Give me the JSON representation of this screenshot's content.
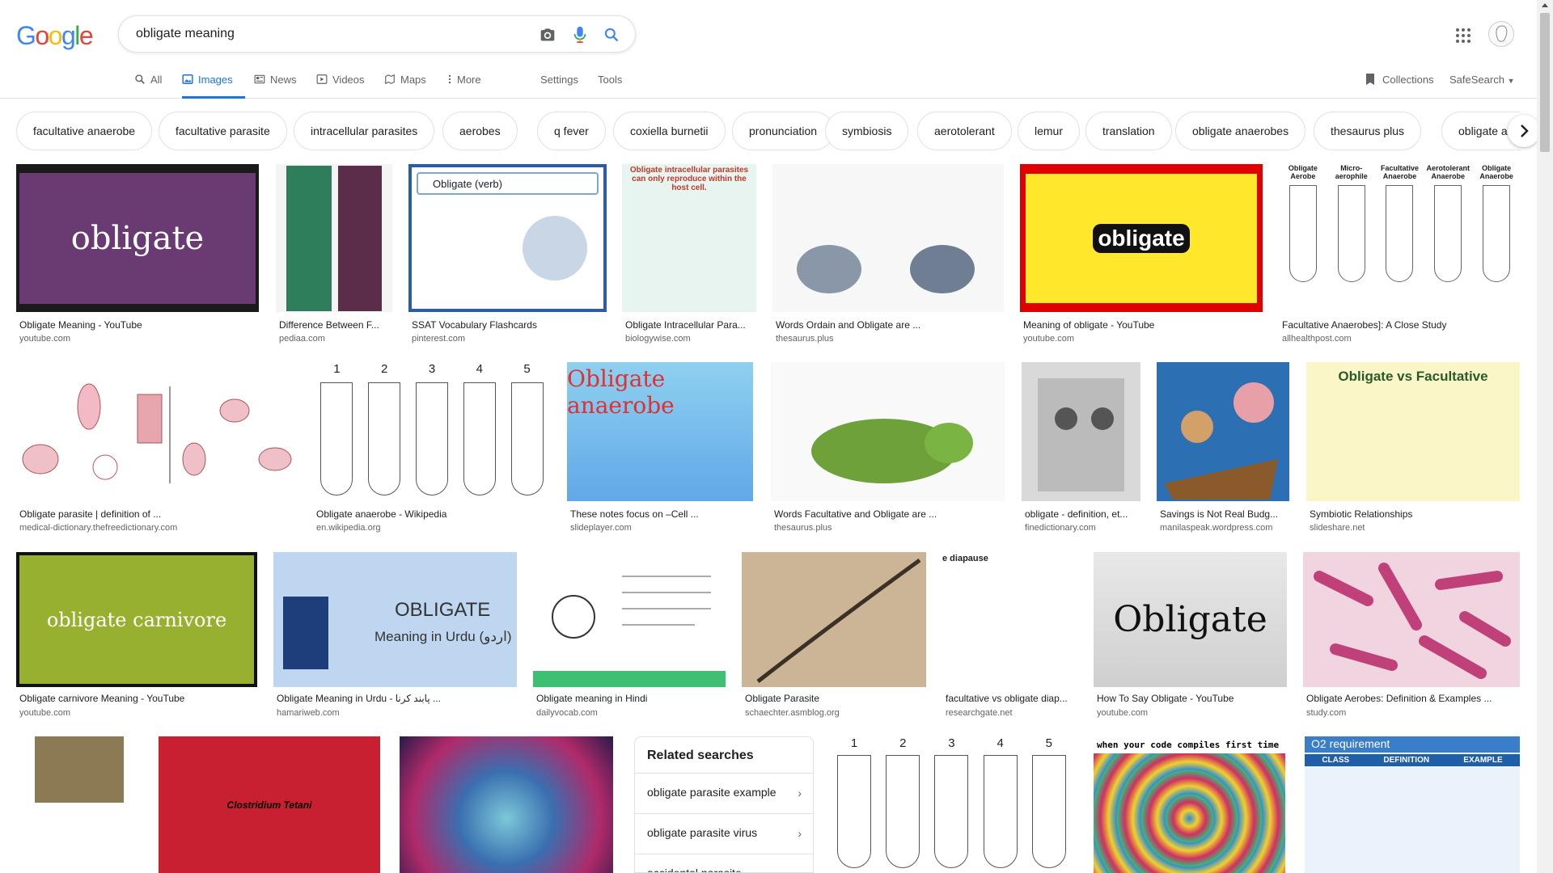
{
  "logo": {
    "letters": [
      {
        "ch": "G",
        "color": "#4285F4"
      },
      {
        "ch": "o",
        "color": "#EA4335"
      },
      {
        "ch": "o",
        "color": "#FBBC05"
      },
      {
        "ch": "g",
        "color": "#4285F4"
      },
      {
        "ch": "l",
        "color": "#34A853"
      },
      {
        "ch": "e",
        "color": "#EA4335"
      }
    ]
  },
  "search": {
    "query": "obligate meaning"
  },
  "icons": {
    "camera": "camera-icon",
    "mic": "mic-icon",
    "search": "search-icon",
    "apps": "apps-grid-icon",
    "collections": "bookmark-icon"
  },
  "tabs": [
    {
      "label": "All",
      "icon": "search-icon"
    },
    {
      "label": "Images",
      "icon": "image-icon",
      "active": true
    },
    {
      "label": "News",
      "icon": "news-icon"
    },
    {
      "label": "Videos",
      "icon": "video-icon"
    },
    {
      "label": "Maps",
      "icon": "map-icon"
    },
    {
      "label": "More",
      "icon": "more-icon"
    },
    {
      "label": "Settings"
    },
    {
      "label": "Tools"
    }
  ],
  "collections_label": "Collections",
  "safesearch_label": "SafeSearch",
  "chips": [
    "facultative anaerobe",
    "facultative parasite",
    "intracellular parasites",
    "aerobes",
    "q fever",
    "coxiella burnetii",
    "pronunciation",
    "symbiosis",
    "aerotolerant",
    "lemur",
    "translation",
    "obligate anaerobes",
    "thesaurus plus",
    "obligate aero"
  ],
  "results": {
    "row1": [
      {
        "caption": "Obligate Meaning - YouTube",
        "source": "youtube.com",
        "thumb_text": "obligate"
      },
      {
        "caption": "Difference Between F...",
        "source": "pediaa.com"
      },
      {
        "caption": "SSAT Vocabulary Flashcards",
        "source": "pinterest.com",
        "thumb_text": "Obligate (verb)"
      },
      {
        "caption": "Obligate Intracellular Para...",
        "source": "biologywise.com",
        "thumb_text": "Obligate intracellular parasites can only reproduce within the host cell."
      },
      {
        "caption": "Words Ordain and Obligate are ...",
        "source": "thesaurus.plus"
      },
      {
        "caption": "Meaning of obligate - YouTube",
        "source": "youtube.com",
        "thumb_text": "obligate"
      },
      {
        "caption": "Facultative Anaerobes]: A Close Study",
        "source": "allhealthpost.com",
        "tube_labels": [
          "Obligate Aerobe",
          "Micro-aerophile",
          "Facultative Anaerobe",
          "Aerotolerant Anaerobe",
          "Obligate Anaerobe"
        ]
      }
    ],
    "row2": [
      {
        "caption": "Obligate parasite | definition of ...",
        "source": "medical-dictionary.thefreedictionary.com"
      },
      {
        "caption": "Obligate anaerobe - Wikipedia",
        "source": "en.wikipedia.org",
        "tube_numbers": [
          "1",
          "2",
          "3",
          "4",
          "5"
        ]
      },
      {
        "caption": "These notes focus on –Cell ...",
        "source": "slideplayer.com",
        "thumb_text": "Obligate anaerobe"
      },
      {
        "caption": "Words Facultative and Obligate are ...",
        "source": "thesaurus.plus"
      },
      {
        "caption": "obligate - definition, et...",
        "source": "finedictionary.com"
      },
      {
        "caption": "Savings is Not Real Budg...",
        "source": "manilaspeak.wordpress.com"
      },
      {
        "caption": "Symbiotic Relationships",
        "source": "slideshare.net",
        "thumb_text": "Obligate vs Facultative"
      }
    ],
    "row3": [
      {
        "caption": "Obligate carnivore Meaning - YouTube",
        "source": "youtube.com",
        "thumb_text": "obligate carnivore"
      },
      {
        "caption": "Obligate Meaning in Urdu - پابند کرنا ...",
        "source": "hamariweb.com",
        "thumb_text": "OBLIGATE",
        "thumb_sub": "Meaning in Urdu (اردو)"
      },
      {
        "caption": "Obligate meaning in Hindi",
        "source": "dailyvocab.com"
      },
      {
        "caption": "Obligate Parasite",
        "source": "schaechter.asmblog.org"
      },
      {
        "caption": "facultative vs obligate diap...",
        "source": "researchgate.net",
        "thumb_text": "e diapause"
      },
      {
        "caption": "How To Say Obligate - YouTube",
        "source": "youtube.com",
        "thumb_text": "Obligate"
      },
      {
        "caption": "Obligate Aerobes: Definition & Examples ...",
        "source": "study.com"
      }
    ],
    "row4": [
      {
        "source": ""
      },
      {
        "thumb_text": "Clostridium Tetani"
      },
      {},
      {
        "tube_numbers": [
          "1",
          "2",
          "3",
          "4",
          "5"
        ]
      },
      {
        "thumb_text": "when your code compiles first time"
      },
      {
        "thumb_text": "O2 requirement",
        "table_headers": [
          "CLASS",
          "DEFINITION",
          "EXAMPLE"
        ]
      }
    ]
  },
  "related": {
    "title": "Related searches",
    "items": [
      "obligate parasite example",
      "obligate parasite virus",
      "accidental parasite"
    ]
  }
}
